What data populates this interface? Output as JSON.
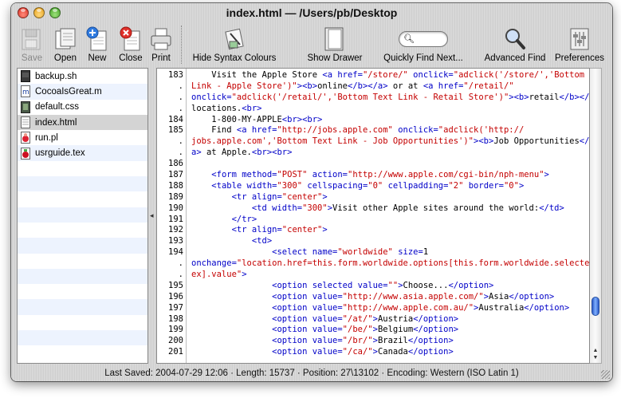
{
  "window": {
    "title": "index.html — /Users/pb/Desktop"
  },
  "toolbar": {
    "save": "Save",
    "open": "Open",
    "new": "New",
    "close": "Close",
    "print": "Print",
    "hide_syntax": "Hide Syntax Colours",
    "show_drawer": "Show Drawer",
    "quick_find": "Quickly Find Next...",
    "advanced_find": "Advanced Find",
    "preferences": "Preferences"
  },
  "files": [
    {
      "name": "backup.sh",
      "icon": "shell-script-icon"
    },
    {
      "name": "CocoaIsGreat.m",
      "icon": "objc-file-icon"
    },
    {
      "name": "default.css",
      "icon": "css-file-icon"
    },
    {
      "name": "index.html",
      "icon": "html-file-icon",
      "selected": true
    },
    {
      "name": "run.pl",
      "icon": "perl-file-icon"
    },
    {
      "name": "usrguide.tex",
      "icon": "tex-file-icon"
    }
  ],
  "code_lines": [
    {
      "no": "183",
      "html": "    Visit the Apple Store <span class=\"t\">&lt;a href=</span><span class=\"s\">\"/store/\"</span><span class=\"t\"> onclick=</span><span class=\"s\">\"adclick('/store/','Bottom Text</span>"
    },
    {
      "no": ".",
      "html": "<span class=\"s\">Link - Apple Store')\"</span><span class=\"t\">&gt;&lt;b&gt;</span>online<span class=\"t\">&lt;/b&gt;&lt;/a&gt;</span> or at <span class=\"t\">&lt;a href=</span><span class=\"s\">\"/retail/\"</span>"
    },
    {
      "no": ".",
      "html": "<span class=\"t\">onclick=</span><span class=\"s\">\"adclick('/retail/','Bottom Text Link - Retail Store')\"</span><span class=\"t\">&gt;&lt;b&gt;</span>retail<span class=\"t\">&lt;/b&gt;&lt;/a&gt;</span>"
    },
    {
      "no": ".",
      "html": "locations.<span class=\"t\">&lt;br&gt;</span>"
    },
    {
      "no": "184",
      "html": "    1-800-MY-APPLE<span class=\"t\">&lt;br&gt;&lt;br&gt;</span>"
    },
    {
      "no": "185",
      "html": "    Find <span class=\"t\">&lt;a href=</span><span class=\"s\">\"http://jobs.apple.com\"</span><span class=\"t\"> onclick=</span><span class=\"s\">\"adclick('http://</span>"
    },
    {
      "no": ".",
      "html": "<span class=\"s\">jobs.apple.com','Bottom Text Link - Job Opportunities')\"</span><span class=\"t\">&gt;&lt;b&gt;</span>Job Opportunities<span class=\"t\">&lt;/b&gt;&lt;/</span>"
    },
    {
      "no": ".",
      "html": "<span class=\"t\">a&gt;</span> at Apple.<span class=\"t\">&lt;br&gt;&lt;br&gt;</span>"
    },
    {
      "no": "186",
      "html": ""
    },
    {
      "no": "187",
      "html": "    <span class=\"t\">&lt;form method=</span><span class=\"s\">\"POST\"</span><span class=\"t\"> action=</span><span class=\"s\">\"http://www.apple.com/cgi-bin/nph-menu\"</span><span class=\"t\">&gt;</span>"
    },
    {
      "no": "188",
      "html": "    <span class=\"t\">&lt;table width=</span><span class=\"s\">\"300\"</span><span class=\"t\"> cellspacing=</span><span class=\"s\">\"0\"</span><span class=\"t\"> cellpadding=</span><span class=\"s\">\"2\"</span><span class=\"t\"> border=</span><span class=\"s\">\"0\"</span><span class=\"t\">&gt;</span>"
    },
    {
      "no": "189",
      "html": "        <span class=\"t\">&lt;tr align=</span><span class=\"s\">\"center\"</span><span class=\"t\">&gt;</span>"
    },
    {
      "no": "190",
      "html": "            <span class=\"t\">&lt;td width=</span><span class=\"s\">\"300\"</span><span class=\"t\">&gt;</span>Visit other Apple sites around the world:<span class=\"t\">&lt;/td&gt;</span>"
    },
    {
      "no": "191",
      "html": "        <span class=\"t\">&lt;/tr&gt;</span>"
    },
    {
      "no": "192",
      "html": "        <span class=\"t\">&lt;tr align=</span><span class=\"s\">\"center\"</span><span class=\"t\">&gt;</span>"
    },
    {
      "no": "193",
      "html": "            <span class=\"t\">&lt;td&gt;</span>"
    },
    {
      "no": "194",
      "html": "                <span class=\"t\">&lt;select name=</span><span class=\"s\">\"worldwide\"</span><span class=\"t\"> size=</span>1"
    },
    {
      "no": ".",
      "html": "<span class=\"t\">onchange=</span><span class=\"s\">\"location.href=this.form.worldwide.options[this.form.worldwide.selectedInd</span>"
    },
    {
      "no": ".",
      "html": "<span class=\"s\">ex].value\"</span><span class=\"t\">&gt;</span>"
    },
    {
      "no": "195",
      "html": "                <span class=\"t\">&lt;option selected value=</span><span class=\"s\">\"\"</span><span class=\"t\">&gt;</span>Choose...<span class=\"t\">&lt;/option&gt;</span>"
    },
    {
      "no": "196",
      "html": "                <span class=\"t\">&lt;option value=</span><span class=\"s\">\"http://www.asia.apple.com/\"</span><span class=\"t\">&gt;</span>Asia<span class=\"t\">&lt;/option&gt;</span>"
    },
    {
      "no": "197",
      "html": "                <span class=\"t\">&lt;option value=</span><span class=\"s\">\"http://www.apple.com.au/\"</span><span class=\"t\">&gt;</span>Australia<span class=\"t\">&lt;/option&gt;</span>"
    },
    {
      "no": "198",
      "html": "                <span class=\"t\">&lt;option value=</span><span class=\"s\">\"/at/\"</span><span class=\"t\">&gt;</span>Austria<span class=\"t\">&lt;/option&gt;</span>"
    },
    {
      "no": "199",
      "html": "                <span class=\"t\">&lt;option value=</span><span class=\"s\">\"/be/\"</span><span class=\"t\">&gt;</span>Belgium<span class=\"t\">&lt;/option&gt;</span>"
    },
    {
      "no": "200",
      "html": "                <span class=\"t\">&lt;option value=</span><span class=\"s\">\"/br/\"</span><span class=\"t\">&gt;</span>Brazil<span class=\"t\">&lt;/option&gt;</span>"
    },
    {
      "no": "201",
      "html": "                <span class=\"t\">&lt;option value=</span><span class=\"s\">\"/ca/\"</span><span class=\"t\">&gt;</span>Canada<span class=\"t\">&lt;/option&gt;</span>"
    }
  ],
  "status": "Last Saved: 2004-07-29 12:06  ·  Length: 15737  ·  Position: 27\\13102  ·  Encoding: Western (ISO Latin 1)"
}
